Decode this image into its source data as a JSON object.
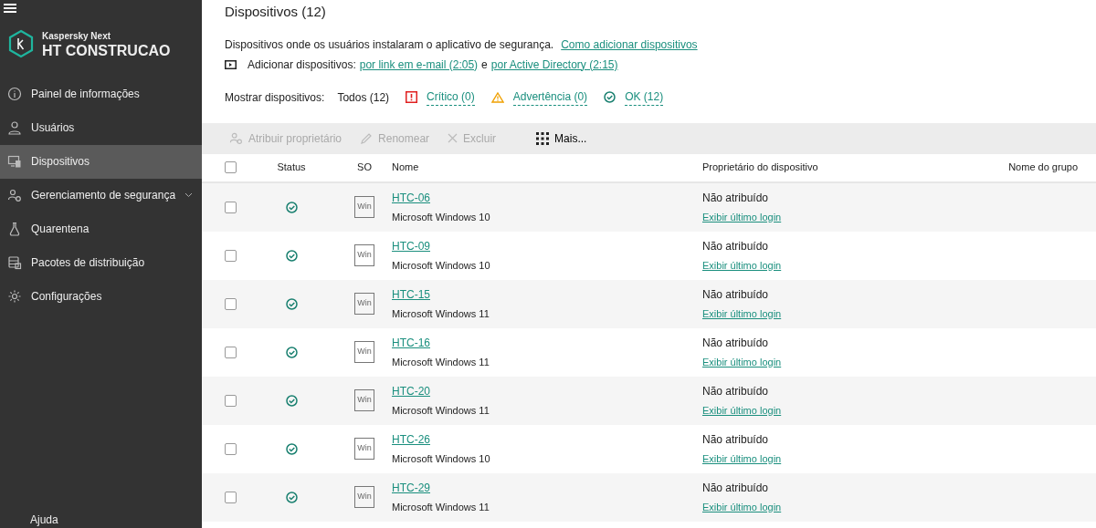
{
  "sidebar": {
    "brand": "Kaspersky Next",
    "workspace": "HT CONSTRUCAO",
    "items": [
      {
        "label": "Painel de informações",
        "kind": "info",
        "selected": false,
        "expandable": false
      },
      {
        "label": "Usuários",
        "kind": "user",
        "selected": false,
        "expandable": false
      },
      {
        "label": "Dispositivos",
        "kind": "devices",
        "selected": true,
        "expandable": false
      },
      {
        "label": "Gerenciamento de segurança",
        "kind": "security",
        "selected": false,
        "expandable": true
      },
      {
        "label": "Quarentena",
        "kind": "quarantine",
        "selected": false,
        "expandable": false
      },
      {
        "label": "Pacotes de distribuição",
        "kind": "packages",
        "selected": false,
        "expandable": false
      },
      {
        "label": "Configurações",
        "kind": "settings",
        "selected": false,
        "expandable": false
      }
    ],
    "footer": "Ajuda"
  },
  "page": {
    "title": "Dispositivos (12)",
    "description": "Dispositivos onde os usuários instalaram o aplicativo de segurança.",
    "help_link": "Como adicionar dispositivos",
    "add_line": {
      "label": "Adicionar dispositivos:",
      "link_1": "por link em e-mail (2:05)",
      "joiner": "e",
      "link_2": "por Active Directory (2:15)"
    },
    "filter": {
      "label": "Mostrar dispositivos:",
      "options": [
        {
          "kind": "all",
          "label": "Todos (12)",
          "selected": true
        },
        {
          "kind": "critical",
          "label": "Crítico (0)",
          "selected": false
        },
        {
          "kind": "warning",
          "label": "Advertência (0)",
          "selected": false
        },
        {
          "kind": "ok",
          "label": "OK (12)",
          "selected": false
        }
      ]
    }
  },
  "toolbar": [
    {
      "kind": "assign",
      "label": "Atribuir proprietário",
      "disabled": true
    },
    {
      "kind": "rename",
      "label": "Renomear",
      "disabled": true
    },
    {
      "kind": "delete",
      "label": "Excluir",
      "disabled": true
    },
    {
      "kind": "more",
      "label": "Mais...",
      "disabled": false
    }
  ],
  "table": {
    "select_all_checked": false,
    "columns": [
      "Status",
      "SO",
      "Nome",
      "Proprietário do dispositivo",
      "Nome do grupo"
    ],
    "rows": [
      {
        "checked": false,
        "os": "Win",
        "name": "HTC-06",
        "system": "Microsoft Windows 10",
        "owner": "Não atribuído",
        "owner_link": "Exibir último login"
      },
      {
        "checked": false,
        "os": "Win",
        "name": "HTC-09",
        "system": "Microsoft Windows 10",
        "owner": "Não atribuído",
        "owner_link": "Exibir último login"
      },
      {
        "checked": false,
        "os": "Win",
        "name": "HTC-15",
        "system": "Microsoft Windows 11",
        "owner": "Não atribuído",
        "owner_link": "Exibir último login"
      },
      {
        "checked": false,
        "os": "Win",
        "name": "HTC-16",
        "system": "Microsoft Windows 11",
        "owner": "Não atribuído",
        "owner_link": "Exibir último login"
      },
      {
        "checked": false,
        "os": "Win",
        "name": "HTC-20",
        "system": "Microsoft Windows 11",
        "owner": "Não atribuído",
        "owner_link": "Exibir último login"
      },
      {
        "checked": false,
        "os": "Win",
        "name": "HTC-26",
        "system": "Microsoft Windows 10",
        "owner": "Não atribuído",
        "owner_link": "Exibir último login"
      },
      {
        "checked": false,
        "os": "Win",
        "name": "HTC-29",
        "system": "Microsoft Windows 11",
        "owner": "Não atribuído",
        "owner_link": "Exibir último login"
      }
    ]
  }
}
